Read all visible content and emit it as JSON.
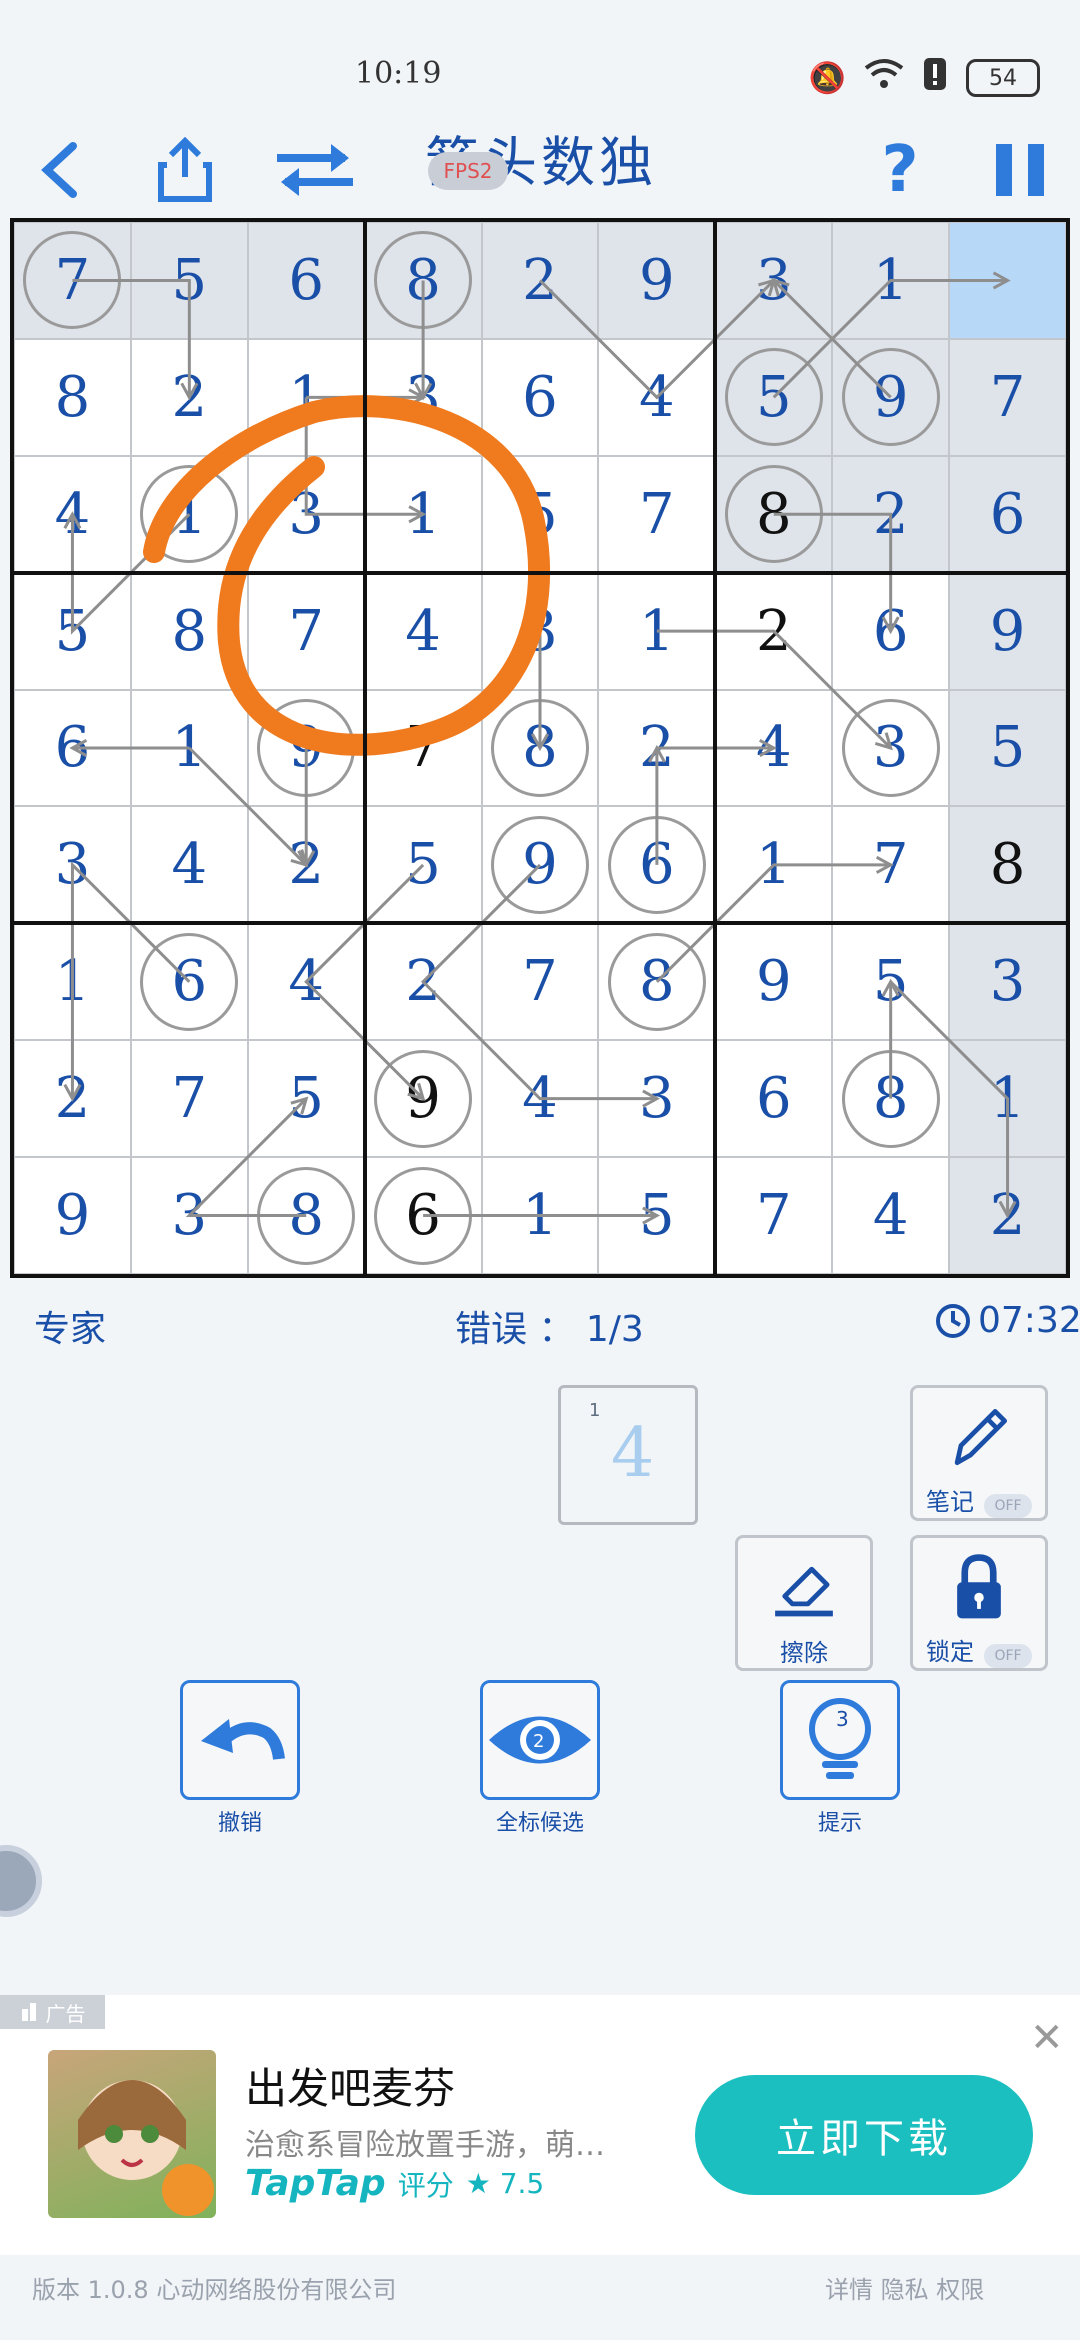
{
  "status": {
    "time": "10:19",
    "battery": "54"
  },
  "toolbar": {
    "title": "箭头数独",
    "fps": "FPS2",
    "help": "?"
  },
  "grid": [
    [
      7,
      5,
      6,
      8,
      2,
      9,
      3,
      1,
      ""
    ],
    [
      8,
      2,
      1,
      3,
      6,
      4,
      5,
      9,
      7
    ],
    [
      4,
      1,
      3,
      1,
      5,
      7,
      8,
      2,
      6
    ],
    [
      5,
      8,
      7,
      4,
      3,
      1,
      2,
      6,
      9
    ],
    [
      6,
      1,
      9,
      7,
      8,
      2,
      4,
      3,
      5
    ],
    [
      3,
      4,
      2,
      5,
      9,
      6,
      1,
      7,
      8
    ],
    [
      1,
      6,
      4,
      2,
      7,
      8,
      9,
      5,
      3
    ],
    [
      2,
      7,
      5,
      9,
      4,
      3,
      6,
      8,
      1
    ],
    [
      9,
      3,
      8,
      6,
      1,
      5,
      7,
      4,
      2
    ]
  ],
  "info": {
    "difficulty": "专家",
    "errors": "错误 ： 1/3",
    "timer": "07:32"
  },
  "selected_digit": {
    "count": "1",
    "digit": "4"
  },
  "tools": {
    "notes": "笔记",
    "notes_state": "OFF",
    "erase": "擦除",
    "lock": "锁定",
    "lock_state": "OFF"
  },
  "actions": {
    "undo": "撤销",
    "candidates": "全标候选",
    "candidates_count": "2",
    "hint": "提示",
    "hint_count": "3"
  },
  "ad": {
    "tag": "广告",
    "title": "出发吧麦芬",
    "desc": "治愈系冒险放置手游，萌…",
    "taptap": "TapTap",
    "rating_label": "评分",
    "rating": "★ 7.5",
    "download": "立即下载"
  },
  "footer": {
    "version": "版本 1.0.8  心动网络股份有限公司",
    "links": "详情   隐私   权限"
  },
  "colors": {
    "accent": "#2f7bdc",
    "digit": "#1a4fa8",
    "ad_button": "#1cbfbf",
    "mark": "#f07a1e"
  }
}
